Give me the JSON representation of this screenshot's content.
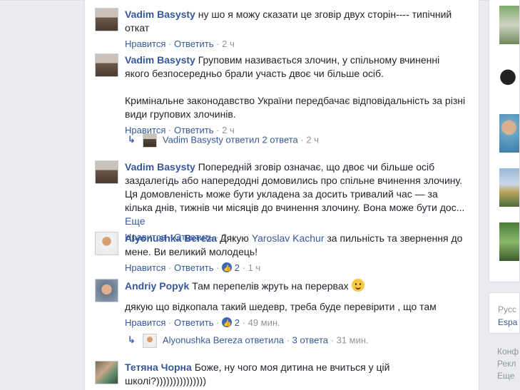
{
  "labels": {
    "like": "Нравится",
    "reply": "Ответить",
    "more": "Еще",
    "sep": "·",
    "replied_verb": "ответил",
    "replied_verb_f": "ответила"
  },
  "comments": [
    {
      "author": "Vadim Basysty",
      "text": "ну шо я можу сказати це зговір двух сторін---- типічний откат",
      "time": "2 ч"
    },
    {
      "author": "Vadim Basysty",
      "text": "Груповим називається злочин, у спільному вчиненні якого безпосередньо брали участь двоє чи більше осіб.",
      "text2": "Кримінальне законодавство України передбачає відповідальність за різні види групових злочинів.",
      "time": "2 ч",
      "replies": {
        "author": "Vadim Basysty",
        "count": "2 ответа",
        "time": "2 ч"
      }
    },
    {
      "author": "Vadim Basysty",
      "text": "Попередній зговір означає, що двоє чи більше осіб заздалегідь або напередодні домовились про спільне вчинення злочину. Ця домовленість може бути укладена за досить тривалий час — за кілька днів, тижнів чи місяців до вчинення злочину. Вона може бути дос...",
      "time": "2 ч"
    },
    {
      "author": "Alyonushka Bereza",
      "text_before": "Дякую",
      "mention": "Yaroslav Kachur",
      "text_after": "за пильність та звернення до мене. Ви великий молодець!",
      "likes": "2",
      "time": "1 ч"
    },
    {
      "author": "Andriy Popyk",
      "text": "Там перепелів жруть на перервах",
      "text2": "дякую що відкопала такий шедевр, треба буде перевірити , що там",
      "likes": "2",
      "time": "49 мин.",
      "replies": {
        "author": "Alyonushka Bereza",
        "count": "3 ответа",
        "time": "31 мин."
      }
    },
    {
      "author": "Тетяна Чорна",
      "text": "Боже, ну чого моя дитина не вчиться у цій школі?)))))))))))))))"
    }
  ],
  "right_rail": {
    "languages": [
      "Русс",
      "Espa"
    ],
    "footer_links": [
      "Конф",
      "Рекл",
      "Еще"
    ]
  },
  "colors": {
    "link": "#365899",
    "meta": "#90949c",
    "background": "#e9ebee",
    "like_badge": "#4267b2"
  }
}
